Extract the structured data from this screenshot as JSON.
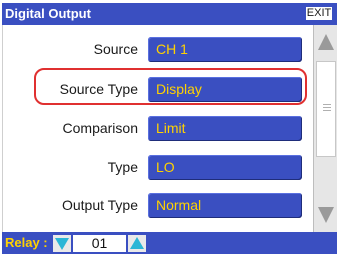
{
  "header": {
    "title": "Digital Output",
    "exit_label": "EXIT"
  },
  "rows": [
    {
      "label": "Source",
      "value": "CH 1"
    },
    {
      "label": "Source Type",
      "value": "Display"
    },
    {
      "label": "Comparison",
      "value": "Limit"
    },
    {
      "label": "Type",
      "value": "LO"
    },
    {
      "label": "Output Type",
      "value": "Normal"
    }
  ],
  "footer": {
    "relay_label": "Relay :",
    "relay_value": "01"
  },
  "colors": {
    "bar_blue": "#3a4fc1",
    "value_text": "#ffd200",
    "highlight": "#e03030",
    "arrow_cyan": "#2bb6d6"
  },
  "icons": {
    "scroll_up": "triangle-up-icon",
    "scroll_down": "triangle-down-icon",
    "relay_down": "triangle-down-icon",
    "relay_up": "triangle-up-icon"
  }
}
